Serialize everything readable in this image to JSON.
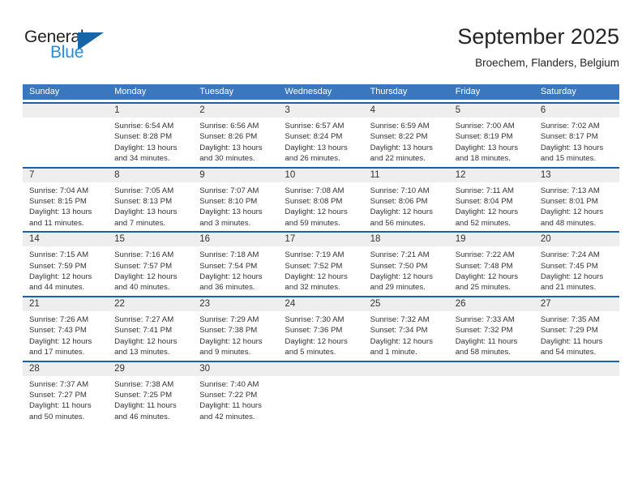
{
  "branding": {
    "logo_text_primary": "General",
    "logo_text_secondary": "Blue",
    "logo_icon": "triangle-flag-icon",
    "primary_color": "#3b77bf",
    "accent_color": "#1565a8",
    "secondary_text_color": "#2b8bd4"
  },
  "header": {
    "month_title": "September 2025",
    "location": "Broechem, Flanders, Belgium"
  },
  "calendar": {
    "weekday_headers": [
      "Sunday",
      "Monday",
      "Tuesday",
      "Wednesday",
      "Thursday",
      "Friday",
      "Saturday"
    ],
    "weeks": [
      [
        {
          "date": "",
          "sunrise": "",
          "sunset": "",
          "daylight_line1": "",
          "daylight_line2": ""
        },
        {
          "date": "1",
          "sunrise": "Sunrise: 6:54 AM",
          "sunset": "Sunset: 8:28 PM",
          "daylight_line1": "Daylight: 13 hours",
          "daylight_line2": "and 34 minutes."
        },
        {
          "date": "2",
          "sunrise": "Sunrise: 6:56 AM",
          "sunset": "Sunset: 8:26 PM",
          "daylight_line1": "Daylight: 13 hours",
          "daylight_line2": "and 30 minutes."
        },
        {
          "date": "3",
          "sunrise": "Sunrise: 6:57 AM",
          "sunset": "Sunset: 8:24 PM",
          "daylight_line1": "Daylight: 13 hours",
          "daylight_line2": "and 26 minutes."
        },
        {
          "date": "4",
          "sunrise": "Sunrise: 6:59 AM",
          "sunset": "Sunset: 8:22 PM",
          "daylight_line1": "Daylight: 13 hours",
          "daylight_line2": "and 22 minutes."
        },
        {
          "date": "5",
          "sunrise": "Sunrise: 7:00 AM",
          "sunset": "Sunset: 8:19 PM",
          "daylight_line1": "Daylight: 13 hours",
          "daylight_line2": "and 18 minutes."
        },
        {
          "date": "6",
          "sunrise": "Sunrise: 7:02 AM",
          "sunset": "Sunset: 8:17 PM",
          "daylight_line1": "Daylight: 13 hours",
          "daylight_line2": "and 15 minutes."
        }
      ],
      [
        {
          "date": "7",
          "sunrise": "Sunrise: 7:04 AM",
          "sunset": "Sunset: 8:15 PM",
          "daylight_line1": "Daylight: 13 hours",
          "daylight_line2": "and 11 minutes."
        },
        {
          "date": "8",
          "sunrise": "Sunrise: 7:05 AM",
          "sunset": "Sunset: 8:13 PM",
          "daylight_line1": "Daylight: 13 hours",
          "daylight_line2": "and 7 minutes."
        },
        {
          "date": "9",
          "sunrise": "Sunrise: 7:07 AM",
          "sunset": "Sunset: 8:10 PM",
          "daylight_line1": "Daylight: 13 hours",
          "daylight_line2": "and 3 minutes."
        },
        {
          "date": "10",
          "sunrise": "Sunrise: 7:08 AM",
          "sunset": "Sunset: 8:08 PM",
          "daylight_line1": "Daylight: 12 hours",
          "daylight_line2": "and 59 minutes."
        },
        {
          "date": "11",
          "sunrise": "Sunrise: 7:10 AM",
          "sunset": "Sunset: 8:06 PM",
          "daylight_line1": "Daylight: 12 hours",
          "daylight_line2": "and 56 minutes."
        },
        {
          "date": "12",
          "sunrise": "Sunrise: 7:11 AM",
          "sunset": "Sunset: 8:04 PM",
          "daylight_line1": "Daylight: 12 hours",
          "daylight_line2": "and 52 minutes."
        },
        {
          "date": "13",
          "sunrise": "Sunrise: 7:13 AM",
          "sunset": "Sunset: 8:01 PM",
          "daylight_line1": "Daylight: 12 hours",
          "daylight_line2": "and 48 minutes."
        }
      ],
      [
        {
          "date": "14",
          "sunrise": "Sunrise: 7:15 AM",
          "sunset": "Sunset: 7:59 PM",
          "daylight_line1": "Daylight: 12 hours",
          "daylight_line2": "and 44 minutes."
        },
        {
          "date": "15",
          "sunrise": "Sunrise: 7:16 AM",
          "sunset": "Sunset: 7:57 PM",
          "daylight_line1": "Daylight: 12 hours",
          "daylight_line2": "and 40 minutes."
        },
        {
          "date": "16",
          "sunrise": "Sunrise: 7:18 AM",
          "sunset": "Sunset: 7:54 PM",
          "daylight_line1": "Daylight: 12 hours",
          "daylight_line2": "and 36 minutes."
        },
        {
          "date": "17",
          "sunrise": "Sunrise: 7:19 AM",
          "sunset": "Sunset: 7:52 PM",
          "daylight_line1": "Daylight: 12 hours",
          "daylight_line2": "and 32 minutes."
        },
        {
          "date": "18",
          "sunrise": "Sunrise: 7:21 AM",
          "sunset": "Sunset: 7:50 PM",
          "daylight_line1": "Daylight: 12 hours",
          "daylight_line2": "and 29 minutes."
        },
        {
          "date": "19",
          "sunrise": "Sunrise: 7:22 AM",
          "sunset": "Sunset: 7:48 PM",
          "daylight_line1": "Daylight: 12 hours",
          "daylight_line2": "and 25 minutes."
        },
        {
          "date": "20",
          "sunrise": "Sunrise: 7:24 AM",
          "sunset": "Sunset: 7:45 PM",
          "daylight_line1": "Daylight: 12 hours",
          "daylight_line2": "and 21 minutes."
        }
      ],
      [
        {
          "date": "21",
          "sunrise": "Sunrise: 7:26 AM",
          "sunset": "Sunset: 7:43 PM",
          "daylight_line1": "Daylight: 12 hours",
          "daylight_line2": "and 17 minutes."
        },
        {
          "date": "22",
          "sunrise": "Sunrise: 7:27 AM",
          "sunset": "Sunset: 7:41 PM",
          "daylight_line1": "Daylight: 12 hours",
          "daylight_line2": "and 13 minutes."
        },
        {
          "date": "23",
          "sunrise": "Sunrise: 7:29 AM",
          "sunset": "Sunset: 7:38 PM",
          "daylight_line1": "Daylight: 12 hours",
          "daylight_line2": "and 9 minutes."
        },
        {
          "date": "24",
          "sunrise": "Sunrise: 7:30 AM",
          "sunset": "Sunset: 7:36 PM",
          "daylight_line1": "Daylight: 12 hours",
          "daylight_line2": "and 5 minutes."
        },
        {
          "date": "25",
          "sunrise": "Sunrise: 7:32 AM",
          "sunset": "Sunset: 7:34 PM",
          "daylight_line1": "Daylight: 12 hours",
          "daylight_line2": "and 1 minute."
        },
        {
          "date": "26",
          "sunrise": "Sunrise: 7:33 AM",
          "sunset": "Sunset: 7:32 PM",
          "daylight_line1": "Daylight: 11 hours",
          "daylight_line2": "and 58 minutes."
        },
        {
          "date": "27",
          "sunrise": "Sunrise: 7:35 AM",
          "sunset": "Sunset: 7:29 PM",
          "daylight_line1": "Daylight: 11 hours",
          "daylight_line2": "and 54 minutes."
        }
      ],
      [
        {
          "date": "28",
          "sunrise": "Sunrise: 7:37 AM",
          "sunset": "Sunset: 7:27 PM",
          "daylight_line1": "Daylight: 11 hours",
          "daylight_line2": "and 50 minutes."
        },
        {
          "date": "29",
          "sunrise": "Sunrise: 7:38 AM",
          "sunset": "Sunset: 7:25 PM",
          "daylight_line1": "Daylight: 11 hours",
          "daylight_line2": "and 46 minutes."
        },
        {
          "date": "30",
          "sunrise": "Sunrise: 7:40 AM",
          "sunset": "Sunset: 7:22 PM",
          "daylight_line1": "Daylight: 11 hours",
          "daylight_line2": "and 42 minutes."
        },
        {
          "date": "",
          "sunrise": "",
          "sunset": "",
          "daylight_line1": "",
          "daylight_line2": ""
        },
        {
          "date": "",
          "sunrise": "",
          "sunset": "",
          "daylight_line1": "",
          "daylight_line2": ""
        },
        {
          "date": "",
          "sunrise": "",
          "sunset": "",
          "daylight_line1": "",
          "daylight_line2": ""
        },
        {
          "date": "",
          "sunrise": "",
          "sunset": "",
          "daylight_line1": "",
          "daylight_line2": ""
        }
      ]
    ]
  }
}
